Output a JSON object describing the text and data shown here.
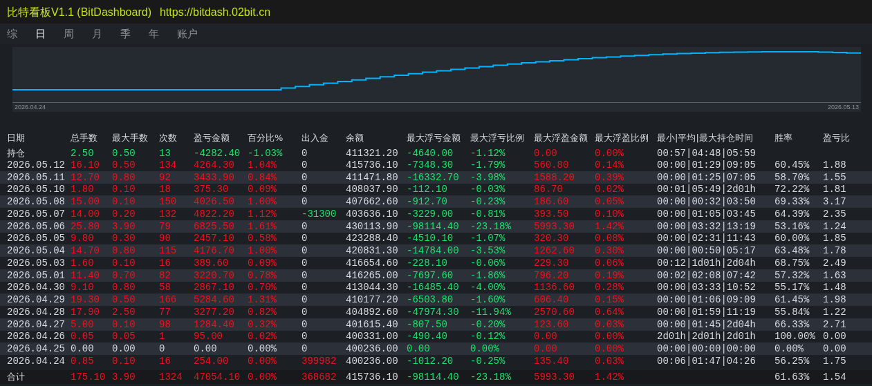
{
  "title": "比特看板V1.1 (BitDashboard)",
  "url": "https://bitdash.02bit.cn",
  "tabs": [
    {
      "label": "综",
      "selected": false
    },
    {
      "label": "日",
      "selected": true
    },
    {
      "label": "周",
      "selected": false
    },
    {
      "label": "月",
      "selected": false
    },
    {
      "label": "季",
      "selected": false
    },
    {
      "label": "年",
      "selected": false
    },
    {
      "label": "账户",
      "selected": false
    }
  ],
  "chart": {
    "start_label": "2026.04.24",
    "end_label": "2026.05.13"
  },
  "columns": [
    "日期",
    "总手数",
    "最大手数",
    "次数",
    "盈亏金额",
    "百分比%",
    "出入金",
    "余额",
    "最大浮亏金额",
    "最大浮亏比例",
    "最大浮盈金额",
    "最大浮盈比例",
    "最小|平均|最大持仓时间",
    "胜率",
    "盈亏比"
  ],
  "rows": [
    {
      "kind": "holding",
      "date": "持仓",
      "lots": "2.50",
      "max_lots": "0.50",
      "trades": "13",
      "pnl": "-4282.40",
      "pct": "-1.03%",
      "flow": {
        "text": "0",
        "kind": "none"
      },
      "balance": "411321.20",
      "float_loss": "-4640.00",
      "float_loss_pct": "-1.12%",
      "float_profit": "0.00",
      "float_profit_pct": "0.00%",
      "time": "00:57|04:48|05:59"
    },
    {
      "kind": "day",
      "date": "2026.05.12",
      "lots": "16.10",
      "max_lots": "0.50",
      "trades": "134",
      "pnl": "4264.30",
      "pct": "1.04%",
      "flow": {
        "text": "0",
        "kind": "none"
      },
      "balance": "415736.10",
      "float_loss": "-7348.30",
      "float_loss_pct": "-1.79%",
      "float_profit": "560.80",
      "float_profit_pct": "0.14%",
      "time": "00:00|01:29|09:05",
      "win": "60.45%",
      "ratio": "1.88"
    },
    {
      "kind": "day",
      "date": "2026.05.11",
      "lots": "12.70",
      "max_lots": "0.80",
      "trades": "92",
      "pnl": "3433.90",
      "pct": "0.84%",
      "flow": {
        "text": "0",
        "kind": "none"
      },
      "balance": "411471.80",
      "float_loss": "-16332.70",
      "float_loss_pct": "-3.98%",
      "float_profit": "1588.20",
      "float_profit_pct": "0.39%",
      "time": "00:00|01:25|07:05",
      "win": "58.70%",
      "ratio": "1.55"
    },
    {
      "kind": "day",
      "date": "2026.05.10",
      "lots": "1.80",
      "max_lots": "0.10",
      "trades": "18",
      "pnl": "375.30",
      "pct": "0.09%",
      "flow": {
        "text": "0",
        "kind": "none"
      },
      "balance": "408037.90",
      "float_loss": "-112.10",
      "float_loss_pct": "-0.03%",
      "float_profit": "86.70",
      "float_profit_pct": "0.02%",
      "time": "00:01|05:49|2d01h",
      "win": "72.22%",
      "ratio": "1.81"
    },
    {
      "kind": "day",
      "date": "2026.05.08",
      "lots": "15.00",
      "max_lots": "0.10",
      "trades": "150",
      "pnl": "4026.50",
      "pct": "1.00%",
      "flow": {
        "text": "0",
        "kind": "none"
      },
      "balance": "407662.60",
      "float_loss": "-912.70",
      "float_loss_pct": "-0.23%",
      "float_profit": "186.60",
      "float_profit_pct": "0.05%",
      "time": "00:00|00:32|03:50",
      "win": "69.33%",
      "ratio": "3.17"
    },
    {
      "kind": "day",
      "date": "2026.05.07",
      "lots": "14.00",
      "max_lots": "0.20",
      "trades": "132",
      "pnl": "4822.20",
      "pct": "1.12%",
      "flow": {
        "text": "-31300",
        "kind": "out"
      },
      "balance": "403636.10",
      "float_loss": "-3229.00",
      "float_loss_pct": "-0.81%",
      "float_profit": "393.50",
      "float_profit_pct": "0.10%",
      "time": "00:00|01:05|03:45",
      "win": "64.39%",
      "ratio": "2.35"
    },
    {
      "kind": "day",
      "date": "2026.05.06",
      "lots": "25.80",
      "max_lots": "3.90",
      "trades": "79",
      "pnl": "6825.50",
      "pct": "1.61%",
      "flow": {
        "text": "0",
        "kind": "none"
      },
      "balance": "430113.90",
      "float_loss": "-98114.40",
      "float_loss_pct": "-23.18%",
      "float_profit": "5993.30",
      "float_profit_pct": "1.42%",
      "time": "00:00|03:32|13:19",
      "win": "53.16%",
      "ratio": "1.24"
    },
    {
      "kind": "day",
      "date": "2026.05.05",
      "lots": "9.80",
      "max_lots": "0.30",
      "trades": "90",
      "pnl": "2457.10",
      "pct": "0.58%",
      "flow": {
        "text": "0",
        "kind": "none"
      },
      "balance": "423288.40",
      "float_loss": "-4510.10",
      "float_loss_pct": "-1.07%",
      "float_profit": "320.30",
      "float_profit_pct": "0.08%",
      "time": "00:00|02:31|11:43",
      "win": "60.00%",
      "ratio": "1.85"
    },
    {
      "kind": "day",
      "date": "2026.05.04",
      "lots": "14.70",
      "max_lots": "0.80",
      "trades": "115",
      "pnl": "4176.70",
      "pct": "1.00%",
      "flow": {
        "text": "0",
        "kind": "none"
      },
      "balance": "420831.30",
      "float_loss": "-14784.00",
      "float_loss_pct": "-3.53%",
      "float_profit": "1262.60",
      "float_profit_pct": "0.30%",
      "time": "00:00|00:50|05:17",
      "win": "63.48%",
      "ratio": "1.78"
    },
    {
      "kind": "day",
      "date": "2026.05.03",
      "lots": "1.60",
      "max_lots": "0.10",
      "trades": "16",
      "pnl": "389.60",
      "pct": "0.09%",
      "flow": {
        "text": "0",
        "kind": "none"
      },
      "balance": "416654.60",
      "float_loss": "-228.10",
      "float_loss_pct": "-0.06%",
      "float_profit": "229.30",
      "float_profit_pct": "0.06%",
      "time": "00:12|1d01h|2d04h",
      "win": "68.75%",
      "ratio": "2.49"
    },
    {
      "kind": "day",
      "date": "2026.05.01",
      "lots": "11.40",
      "max_lots": "0.70",
      "trades": "82",
      "pnl": "3220.70",
      "pct": "0.78%",
      "flow": {
        "text": "0",
        "kind": "none"
      },
      "balance": "416265.00",
      "float_loss": "-7697.60",
      "float_loss_pct": "-1.86%",
      "float_profit": "796.20",
      "float_profit_pct": "0.19%",
      "time": "00:02|02:08|07:42",
      "win": "57.32%",
      "ratio": "1.63"
    },
    {
      "kind": "day",
      "date": "2026.04.30",
      "lots": "9.10",
      "max_lots": "0.80",
      "trades": "58",
      "pnl": "2867.10",
      "pct": "0.70%",
      "flow": {
        "text": "0",
        "kind": "none"
      },
      "balance": "413044.30",
      "float_loss": "-16485.40",
      "float_loss_pct": "-4.00%",
      "float_profit": "1136.60",
      "float_profit_pct": "0.28%",
      "time": "00:00|03:33|10:52",
      "win": "55.17%",
      "ratio": "1.48"
    },
    {
      "kind": "day",
      "date": "2026.04.29",
      "lots": "19.30",
      "max_lots": "0.50",
      "trades": "166",
      "pnl": "5284.60",
      "pct": "1.31%",
      "flow": {
        "text": "0",
        "kind": "none"
      },
      "balance": "410177.20",
      "float_loss": "-6503.80",
      "float_loss_pct": "-1.60%",
      "float_profit": "606.40",
      "float_profit_pct": "0.15%",
      "time": "00:00|01:06|09:09",
      "win": "61.45%",
      "ratio": "1.98"
    },
    {
      "kind": "day",
      "date": "2026.04.28",
      "lots": "17.90",
      "max_lots": "2.50",
      "trades": "77",
      "pnl": "3277.20",
      "pct": "0.82%",
      "flow": {
        "text": "0",
        "kind": "none"
      },
      "balance": "404892.60",
      "float_loss": "-47974.30",
      "float_loss_pct": "-11.94%",
      "float_profit": "2570.60",
      "float_profit_pct": "0.64%",
      "time": "00:00|01:59|11:19",
      "win": "55.84%",
      "ratio": "1.22"
    },
    {
      "kind": "day",
      "date": "2026.04.27",
      "lots": "5.00",
      "max_lots": "0.10",
      "trades": "98",
      "pnl": "1284.40",
      "pct": "0.32%",
      "flow": {
        "text": "0",
        "kind": "none"
      },
      "balance": "401615.40",
      "float_loss": "-807.50",
      "float_loss_pct": "-0.20%",
      "float_profit": "123.60",
      "float_profit_pct": "0.03%",
      "time": "00:00|01:45|2d04h",
      "win": "66.33%",
      "ratio": "2.71"
    },
    {
      "kind": "day",
      "date": "2026.04.26",
      "lots": "0.05",
      "max_lots": "0.05",
      "trades": "1",
      "pnl": "95.00",
      "pct": "0.02%",
      "flow": {
        "text": "0",
        "kind": "none"
      },
      "balance": "400331.00",
      "float_loss": "-490.40",
      "float_loss_pct": "-0.12%",
      "float_profit": "0.00",
      "float_profit_pct": "0.00%",
      "time": "2d01h|2d01h|2d01h",
      "win": "100.00%",
      "ratio": "0.00"
    },
    {
      "kind": "flat",
      "date": "2026.04.25",
      "lots": "0.00",
      "max_lots": "0.00",
      "trades": "0",
      "pnl": "0.00",
      "pct": "0.00%",
      "flow": {
        "text": "0",
        "kind": "none"
      },
      "balance": "400236.00",
      "float_loss": "0.00",
      "float_loss_pct": "0.00%",
      "float_profit": "0.00",
      "float_profit_pct": "0.00%",
      "time": "00:00|00:00|00:00",
      "win": "0.00%",
      "ratio": "0.00"
    },
    {
      "kind": "day",
      "date": "2026.04.24",
      "lots": "0.85",
      "max_lots": "0.10",
      "trades": "16",
      "pnl": "254.00",
      "pct": "0.00%",
      "flow": {
        "text": "399982",
        "kind": "in"
      },
      "balance": "400236.00",
      "float_loss": "-1012.20",
      "float_loss_pct": "-0.25%",
      "float_profit": "135.40",
      "float_profit_pct": "0.03%",
      "time": "00:06|01:47|04:26",
      "win": "56.25%",
      "ratio": "1.75"
    },
    {
      "kind": "total",
      "date": "合计",
      "lots": "175.10",
      "max_lots": "3.90",
      "trades": "1324",
      "pnl": "47054.10",
      "pct": "0.00%",
      "flow": {
        "text": "368682",
        "kind": "in"
      },
      "balance": "415736.10",
      "float_loss": "-98114.40",
      "float_loss_pct": "-23.18%",
      "float_profit": "5993.30",
      "float_profit_pct": "1.42%",
      "win": "61.63%",
      "ratio": "1.54"
    }
  ]
}
